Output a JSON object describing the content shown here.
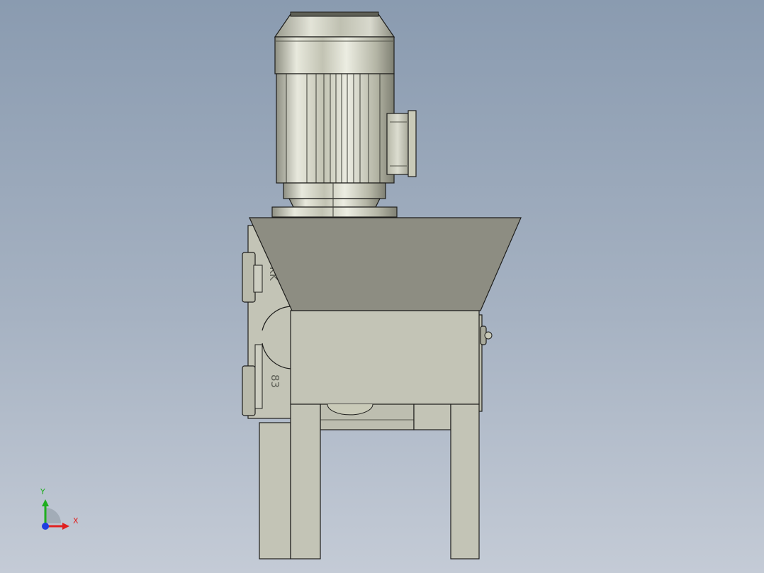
{
  "view": {
    "background_top": "#8a9bb0",
    "background_bottom": "#c4cbd6"
  },
  "model": {
    "engravings": {
      "gearbox_logo": "KK",
      "gearbox_size": "83"
    },
    "colors": {
      "motor_metal": "#c9cab8",
      "frame_body": "#c3c4b6",
      "hopper": "#8d8d82",
      "outline": "#1e1e1c"
    }
  },
  "triad": {
    "x_label": "X",
    "y_label": "Y",
    "x_color": "#e02020",
    "y_color": "#1fae1f",
    "z_color": "#1f3ee0",
    "icons": [
      "x-axis-arrow",
      "y-axis-arrow",
      "z-axis-origin"
    ]
  }
}
